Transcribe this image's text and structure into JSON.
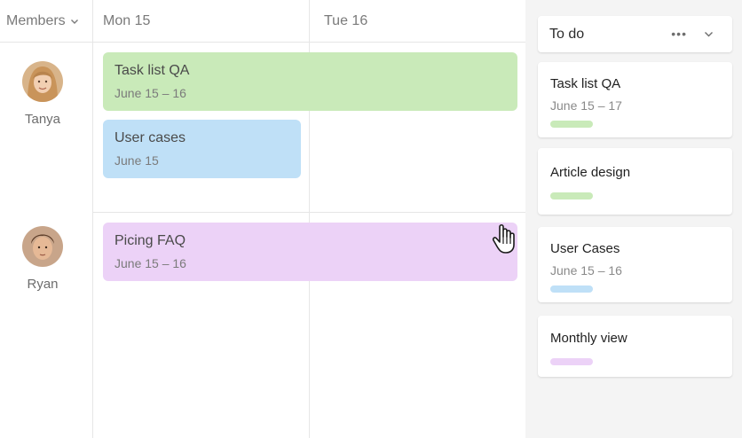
{
  "header": {
    "members_label": "Members",
    "days": [
      "Mon 15",
      "Tue 16"
    ]
  },
  "members": [
    {
      "name": "Tanya"
    },
    {
      "name": "Ryan"
    }
  ],
  "tasks": [
    {
      "title": "Task list QA",
      "dates": "June 15 – 16",
      "color": "#c9eab9"
    },
    {
      "title": "User cases",
      "dates": "June 15",
      "color": "#bfe0f7"
    },
    {
      "title": "Picing FAQ",
      "dates": "June 15 –  16",
      "color": "#ecd2f7"
    }
  ],
  "todo": {
    "title": "To do",
    "more_icon": "more-horizontal-icon",
    "cards": [
      {
        "title": "Task list QA",
        "dates": "June 15 – 17",
        "tag_color": "#c9eab9"
      },
      {
        "title": "Article design",
        "dates": "",
        "tag_color": "#c9eab9"
      },
      {
        "title": "User Cases",
        "dates": "June 15 – 16",
        "tag_color": "#bfe0f7"
      },
      {
        "title": "Monthly view",
        "dates": "",
        "tag_color": "#ecd2f7"
      }
    ]
  }
}
